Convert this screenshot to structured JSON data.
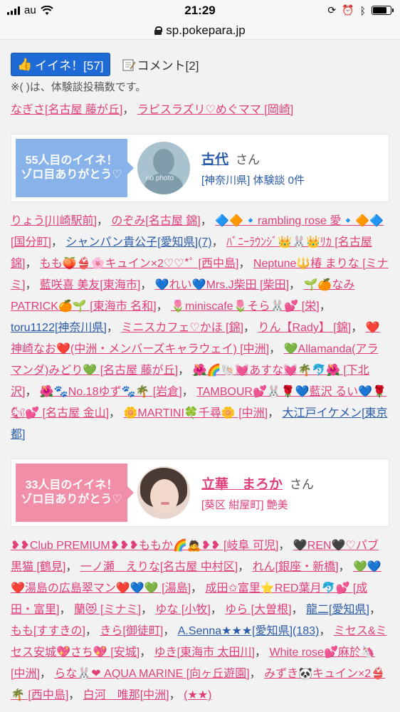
{
  "status_bar": {
    "carrier": "au",
    "time": "21:29"
  },
  "url_bar": {
    "domain": "sp.pokepara.jp"
  },
  "like_button": {
    "label": "イイネ！[57]"
  },
  "comment_link": {
    "label": "コメント[2]"
  },
  "note": "※( )は、体験談投稿数です。",
  "top_likers": [
    {
      "text": "なぎさ[名古屋 藤が丘]",
      "sep": "，"
    },
    {
      "text": "ラピスラズリ♡めぐママ [岡崎]",
      "sep": ""
    }
  ],
  "card1": {
    "badge": "55人目のイイネ！ゾロ目ありがとう♡",
    "photo_label": "no photo",
    "name": "古代",
    "honorific": "さん",
    "sub": "[神奈川県] 体験談 0件"
  },
  "likers1": [
    {
      "text": "りょう[川崎駅前]",
      "sep": "，",
      "color": "pink"
    },
    {
      "text": "のぞみ[名古屋 錦]",
      "sep": "，",
      "color": "pink"
    },
    {
      "text": "🔷🔶🔹rambling rose 愛🔹🔶🔷 [国分町]",
      "sep": "，",
      "color": "pink"
    },
    {
      "text": "シャンパン貴公子[愛知県](7)",
      "sep": "，",
      "color": "blue"
    },
    {
      "text": "ﾊﾞﾆｰﾗｳﾝｼﾞ👑🐰👑ﾘｶ [名古屋 錦]",
      "sep": "，",
      "color": "pink"
    },
    {
      "text": "もも🍑👙🌸キュイン×2♡♡*ﾟ [西中島]",
      "sep": "，",
      "color": "pink"
    },
    {
      "text": "Neptune🔱椿 まりな [ミナミ]",
      "sep": "，",
      "color": "pink"
    },
    {
      "text": "藍咲喜 美友[東海市]",
      "sep": "，",
      "color": "pink"
    },
    {
      "text": "💙れい💙Mrs.J柴田 [柴田]",
      "sep": "，",
      "color": "pink"
    },
    {
      "text": "🌱🍊なみPATRICK🍊🌱 [東海市 名和]",
      "sep": "，",
      "color": "pink"
    },
    {
      "text": "🌷miniscafe🌷そら🐰💕 [栄]",
      "sep": "，",
      "color": "pink"
    },
    {
      "text": "toru1122[神奈川県]",
      "sep": "，",
      "color": "blue"
    },
    {
      "text": "ミニスカフェ♡かほ [錦]",
      "sep": "，",
      "color": "pink"
    },
    {
      "text": "りん【Rady】 [錦]",
      "sep": "，",
      "color": "pink"
    },
    {
      "text": "❤️神崎なお❤️(中洲・メンバーズキャラウェイ) [中洲]",
      "sep": "，",
      "color": "pink"
    },
    {
      "text": "💚Allamanda(アラマンダ)みどり💚 [名古屋 藤が丘]",
      "sep": "，",
      "color": "pink"
    },
    {
      "text": "🌺🌈🐚💓あすな💓🌴🐬🌺 [下北沢]",
      "sep": "，",
      "color": "pink"
    },
    {
      "text": "🌺🐾No.18ゆず🐾🌴 [岩倉]",
      "sep": "，",
      "color": "pink"
    },
    {
      "text": "TAMBOUR💕🐰🌹💙藍沢 るい💙🌹🐿💕 [名古屋 金山]",
      "sep": "，",
      "color": "pink"
    },
    {
      "text": "🌼MARTINI🍀千尋🌼 [中洲]",
      "sep": "，",
      "color": "pink"
    },
    {
      "text": "大江戸イケメン[東京都]",
      "sep": "",
      "color": "blue"
    }
  ],
  "card2": {
    "badge": "33人目のイイネ！ゾロ目ありがとう♡",
    "name": "立華　まろか",
    "honorific": "さん",
    "sub": "[葵区 紺屋町] 艶美"
  },
  "likers2": [
    {
      "text": "❥❥Club PREMIUM❥❥❥ももか🌈🙇❥❥ [岐阜 可児]",
      "sep": "，",
      "color": "pink"
    },
    {
      "text": "🖤REN🖤♡パブ黒猫 [鶴見]",
      "sep": "，",
      "color": "pink"
    },
    {
      "text": "一ノ瀬　えりな[名古屋 中村区]",
      "sep": "，",
      "color": "pink"
    },
    {
      "text": "れん[銀座・新橋]",
      "sep": "，",
      "color": "pink"
    },
    {
      "text": "💚💙❤️湯島の広島翠マン❤️💙💚 [湯島]",
      "sep": "，",
      "color": "pink"
    },
    {
      "text": "成田✩富里⭐RED葉月🐬💕 [成田・富里]",
      "sep": "，",
      "color": "pink"
    },
    {
      "text": "蘭😻 [ミナミ]",
      "sep": "，",
      "color": "pink"
    },
    {
      "text": "ゆな [小牧]",
      "sep": "，",
      "color": "pink"
    },
    {
      "text": "ゆら [大曽根]",
      "sep": "，",
      "color": "pink"
    },
    {
      "text": "龍二[愛知県]",
      "sep": "，",
      "color": "blue"
    },
    {
      "text": "もも[すすきの]",
      "sep": "，",
      "color": "pink"
    },
    {
      "text": "きら[御徒町]",
      "sep": "，",
      "color": "pink"
    },
    {
      "text": "A.Senna★★★[愛知県](183)",
      "sep": "，",
      "color": "blue"
    },
    {
      "text": "ミセス&ミセス安城💖さち💖 [安城]",
      "sep": "，",
      "color": "pink"
    },
    {
      "text": "ゆき[東海市 太田川]",
      "sep": "，",
      "color": "pink"
    },
    {
      "text": "White rose💕麻於🦄 [中洲]",
      "sep": "，",
      "color": "pink"
    },
    {
      "text": "らな🐰❤ AQUA MARINE [向ヶ丘遊園]",
      "sep": "，",
      "color": "pink"
    },
    {
      "text": "みずき🐼キュイン×2👙🌴 [西中島]",
      "sep": "，",
      "color": "pink"
    },
    {
      "text": "白河　唯那[中洲]",
      "sep": "，",
      "color": "pink"
    },
    {
      "text": "(★★)",
      "sep": "",
      "color": "pink"
    }
  ]
}
